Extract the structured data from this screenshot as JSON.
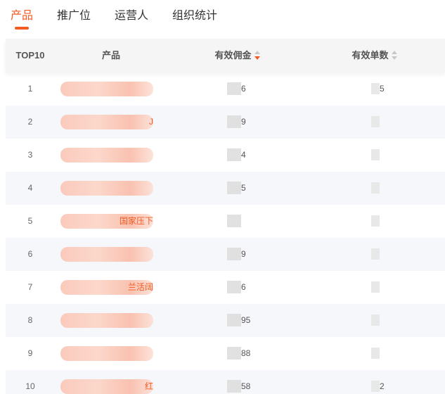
{
  "tabs": [
    {
      "label": "产品",
      "active": true
    },
    {
      "label": "推广位",
      "active": false
    },
    {
      "label": "运营人",
      "active": false
    },
    {
      "label": "组织统计",
      "active": false
    }
  ],
  "table": {
    "columns": {
      "rank": "TOP10",
      "product": "产品",
      "commission": "有效佣金",
      "orders": "有效单数"
    },
    "sort": {
      "column": "commission",
      "direction": "desc"
    },
    "rows": [
      {
        "rank": "1",
        "product": "",
        "commission": "6",
        "orders": "5"
      },
      {
        "rank": "2",
        "product": "J",
        "commission": "9",
        "orders": ""
      },
      {
        "rank": "3",
        "product": "",
        "commission": "4",
        "orders": ""
      },
      {
        "rank": "4",
        "product": "",
        "commission": "5",
        "orders": ""
      },
      {
        "rank": "5",
        "product": "国家压下",
        "commission": "",
        "orders": ""
      },
      {
        "rank": "6",
        "product": "",
        "commission": "9",
        "orders": ""
      },
      {
        "rank": "7",
        "product": "兰活阔",
        "commission": "6",
        "orders": ""
      },
      {
        "rank": "8",
        "product": "",
        "commission": "95",
        "orders": ""
      },
      {
        "rank": "9",
        "product": "",
        "commission": "88",
        "orders": ""
      },
      {
        "rank": "10",
        "product": "红",
        "commission": "58",
        "orders": "2"
      }
    ]
  },
  "colors": {
    "accent": "#f25a22",
    "header_bg": "#f5f5f6",
    "alt_row_bg": "#f5f7fb"
  }
}
